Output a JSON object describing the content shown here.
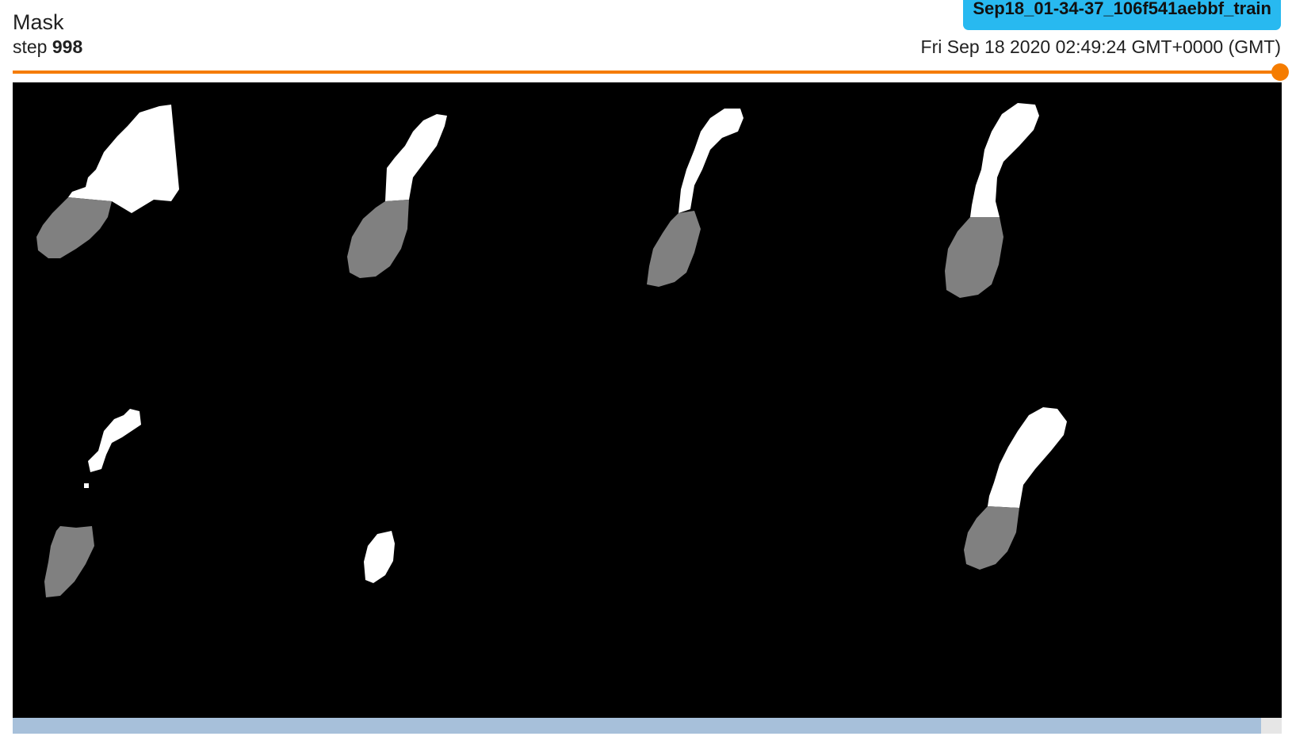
{
  "card": {
    "title": "Mask",
    "step_label": "step",
    "step_value": "998",
    "run_name": "Sep18_01-34-37_106f541aebbf_train",
    "timestamp": "Fri Sep 18 2020 02:49:24 GMT+0000 (GMT)"
  },
  "step_slider": {
    "value_fraction": 1.0
  },
  "image": {
    "kind": "segmentation mask grid",
    "background_color": "#000000",
    "foreground_color": "#ffffff",
    "secondary_color": "#808080",
    "rows": 2,
    "columns": 4
  },
  "scrollbar": {
    "thumb_fraction": 0.984
  },
  "colors": {
    "slider": "#f57c00",
    "run_badge": "#28b9f0",
    "scroll_thumb": "#a7c0da",
    "scroll_track": "#e6e6e6"
  }
}
